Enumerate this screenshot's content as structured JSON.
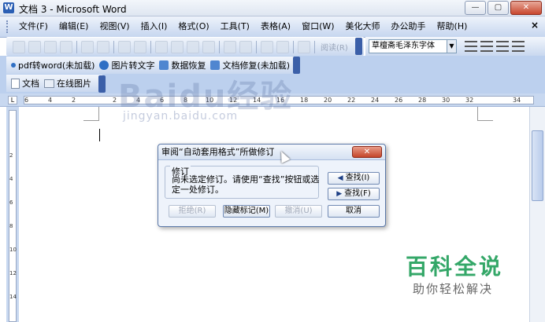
{
  "window": {
    "app_icon": "W",
    "title": "文档 3 - Microsoft Word",
    "minimize_glyph": "—",
    "restore_glyph": "▢",
    "close_glyph": "✕"
  },
  "menubar": {
    "items": [
      "文件(F)",
      "编辑(E)",
      "视图(V)",
      "插入(I)",
      "格式(O)",
      "工具(T)",
      "表格(A)",
      "窗口(W)",
      "美化大师",
      "办公助手",
      "帮助(H)"
    ],
    "close_glyph": "×"
  },
  "toolbar_standard": {
    "read_label": "阅读(R)"
  },
  "toolbar_formatting": {
    "font_name": "草檀斋毛泽东字体"
  },
  "toolbar_plugins": {
    "items": [
      "pdf转word(未加载)",
      "图片转文字",
      "数据恢复",
      "文档修复(未加载)"
    ]
  },
  "toolbar_web": {
    "doc_label": "文档",
    "web_label": "在线图片"
  },
  "ruler": {
    "tab_selector": "L",
    "marks": [
      "6",
      "4",
      "2",
      "2",
      "4",
      "6",
      "8",
      "10",
      "12",
      "14",
      "16",
      "18",
      "20",
      "22",
      "24",
      "26",
      "28",
      "30",
      "32",
      "34"
    ],
    "vmarks": [
      "2",
      "4",
      "6",
      "8",
      "10",
      "12",
      "14"
    ]
  },
  "watermark": {
    "text": "Baidu经验",
    "sub": "jingyan.baidu.com"
  },
  "dialog": {
    "title": "审阅“自动套用格式”所做修订",
    "close_glyph": "✕",
    "group_label": "修订",
    "message": "尚未选定修订。请使用“查找”按钮或选定一处修订。",
    "find_prev": "查找(I)",
    "find_next": "查找(F)",
    "reject": "拒绝(R)",
    "hide_marks": "隐藏标记(M)",
    "undo": "撤消(U)",
    "cancel": "取消"
  },
  "brand": {
    "title": "百科全说",
    "subtitle": "助你轻松解决"
  }
}
